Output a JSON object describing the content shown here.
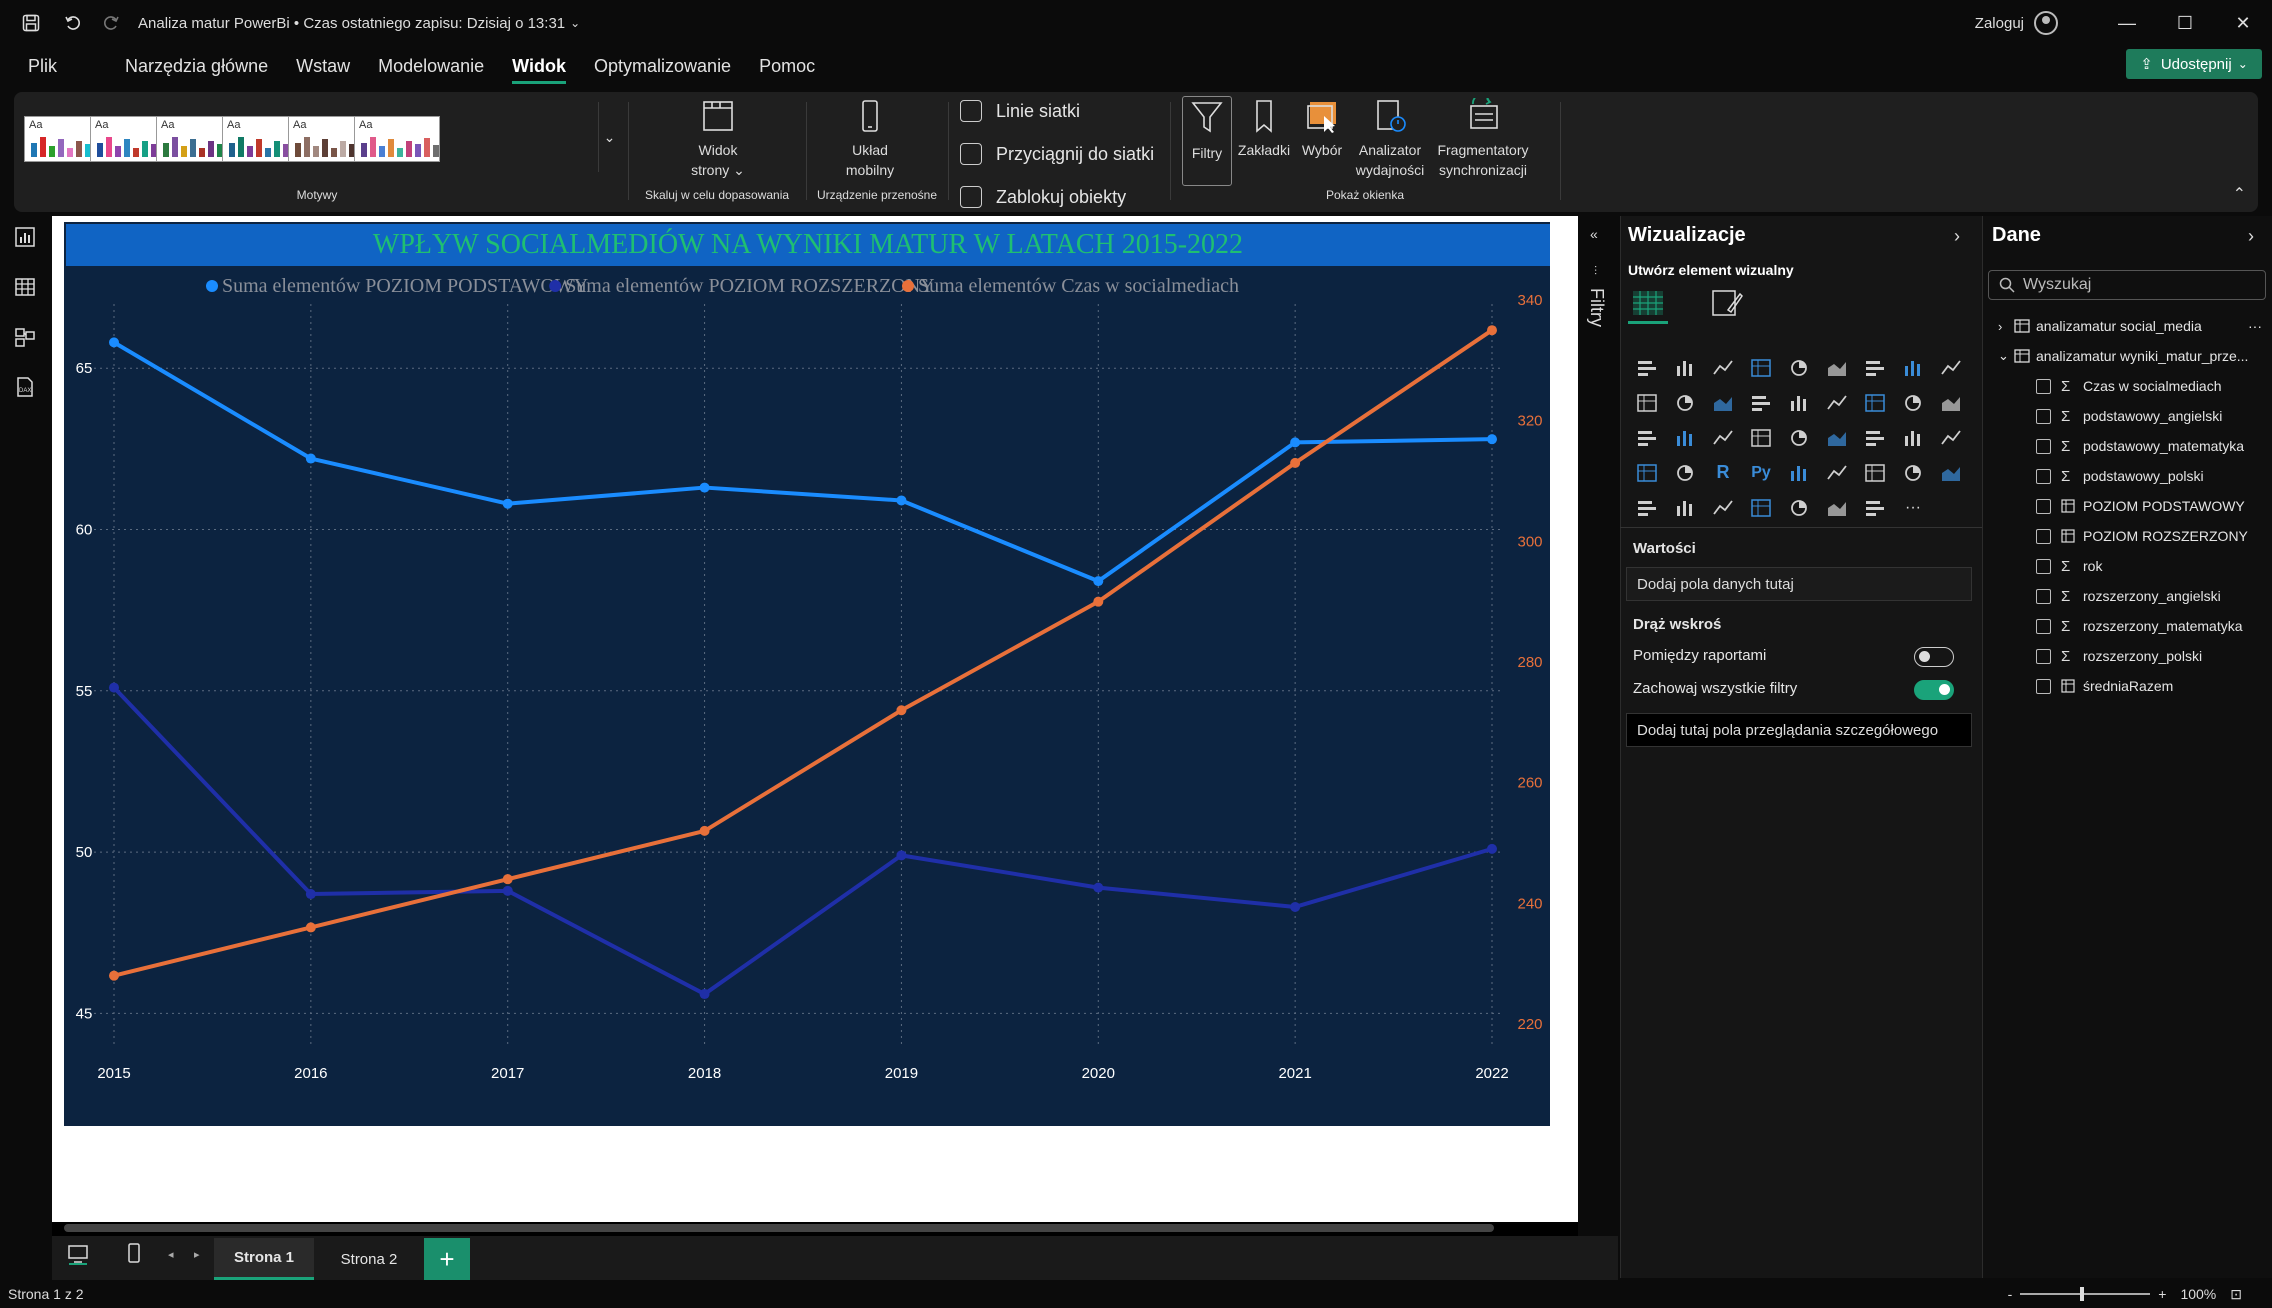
{
  "titlebar": {
    "title": "Analiza matur PowerBi • Czas ostatniego zapisu: Dzisiaj o 13:31",
    "login": "Zaloguj"
  },
  "menu": [
    {
      "label": "Plik"
    },
    {
      "label": "Narzędzia główne"
    },
    {
      "label": "Wstaw"
    },
    {
      "label": "Modelowanie"
    },
    {
      "label": "Widok",
      "active": true
    },
    {
      "label": "Optymalizowanie"
    },
    {
      "label": "Pomoc"
    }
  ],
  "share_label": "Udostępnij",
  "ribbon": {
    "themes_label": "Motywy",
    "page_view": "Widok",
    "page_view_2": "strony",
    "page_view_group": "Skaluj w celu dopasowania",
    "mobile": "Układ",
    "mobile_2": "mobilny",
    "mobile_group": "Urządzenie przenośne",
    "gridlines": "Linie siatki",
    "snap": "Przyciągnij do siatki",
    "lock": "Zablokuj obiekty",
    "filters": "Filtry",
    "bookmarks": "Zakładki",
    "selection": "Wybór",
    "perf": "Analizator",
    "perf_2": "wydajności",
    "sync": "Fragmentatory",
    "sync_2": "synchronizacji",
    "show_panes": "Pokaż okienka",
    "theme_colors": [
      [
        "#1f77b4",
        "#d62728",
        "#2ca02c",
        "#9467bd",
        "#e377c2",
        "#8c564b",
        "#17becf",
        "#bcbd22",
        "#7f7f7f"
      ],
      [
        "#1f4e9c",
        "#e8478b",
        "#8e44ad",
        "#2e86c1",
        "#c0392b",
        "#16a085",
        "#7d3c98",
        "#d35400",
        "#34495e"
      ],
      [
        "#2c7a3f",
        "#7b4fa0",
        "#d4a017",
        "#3c6e91",
        "#a93226",
        "#6c3483",
        "#1e8449",
        "#b9770e",
        "#5d6d7e"
      ],
      [
        "#1f618d",
        "#117a65",
        "#7d3c98",
        "#c0392b",
        "#2874a6",
        "#148f77",
        "#884ea0",
        "#ca6f1e",
        "#424949"
      ],
      [
        "#6e4b3a",
        "#8d6e63",
        "#a1887f",
        "#5d4037",
        "#795548",
        "#bcaaa4",
        "#4e342e",
        "#3e2723",
        "#9e9e9e"
      ],
      [
        "#5b3f8c",
        "#e05a8a",
        "#4a7fd4",
        "#e08a3c",
        "#3cb39b",
        "#c2417a",
        "#7a56b8",
        "#d95f5f",
        "#6e6e6e"
      ]
    ]
  },
  "filters_label": "Filtry",
  "chart_data": {
    "type": "line",
    "title": "WPŁYW SOCIALMEDIÓW NA WYNIKI MATUR W LATACH 2015-2022",
    "x": [
      "2015",
      "2016",
      "2017",
      "2018",
      "2019",
      "2020",
      "2021",
      "2022"
    ],
    "series": [
      {
        "name": "Suma elementów POZIOM PODSTAWOWY",
        "color": "#1a8cff",
        "axis": "left",
        "values": [
          65.8,
          62.2,
          60.8,
          61.3,
          60.9,
          58.4,
          62.7,
          62.8
        ]
      },
      {
        "name": "Suma elementów POZIOM ROZSZERZONY",
        "color": "#1f2fa8",
        "axis": "left",
        "values": [
          55.1,
          48.7,
          48.8,
          45.6,
          49.9,
          48.9,
          48.3,
          50.1
        ]
      },
      {
        "name": "Suma elementów Czas w socialmediach",
        "color": "#e8703a",
        "axis": "right",
        "values": [
          228,
          236,
          244,
          252,
          272,
          290,
          313,
          335
        ]
      }
    ],
    "y_left": {
      "min": 44.3,
      "max": 67.3,
      "ticks": [
        45,
        50,
        55,
        60,
        65
      ]
    },
    "y_right": {
      "min": 218,
      "max": 341,
      "ticks": [
        220,
        240,
        260,
        280,
        300,
        320,
        340
      ]
    },
    "grid": true,
    "legend": "top-center"
  },
  "viz": {
    "title": "Wizualizacje",
    "build": "Utwórz element wizualny",
    "values_label": "Wartości",
    "values_placeholder": "Dodaj pola danych tutaj",
    "drill_label": "Drąż wskroś",
    "cross_report": "Pomiędzy raportami",
    "keep_filters": "Zachowaj wszystkie filtry",
    "drill_placeholder": "Dodaj tutaj pola przeglądania szczegółowego",
    "r_label": "R",
    "py_label": "Py",
    "more_label": "···"
  },
  "data_pane": {
    "title": "Dane",
    "search_placeholder": "Wyszukaj",
    "tables": [
      "analizamatur social_media",
      "analizamatur wyniki_matur_prze..."
    ],
    "fields": [
      {
        "name": "Czas w socialmediach",
        "type": "sum"
      },
      {
        "name": "podstawowy_angielski",
        "type": "sum"
      },
      {
        "name": "podstawowy_matematyka",
        "type": "sum"
      },
      {
        "name": "podstawowy_polski",
        "type": "sum"
      },
      {
        "name": "POZIOM PODSTAWOWY",
        "type": "calc"
      },
      {
        "name": "POZIOM ROZSZERZONY",
        "type": "calc"
      },
      {
        "name": "rok",
        "type": "sum"
      },
      {
        "name": "rozszerzony_angielski",
        "type": "sum"
      },
      {
        "name": "rozszerzony_matematyka",
        "type": "sum"
      },
      {
        "name": "rozszerzony_polski",
        "type": "sum"
      },
      {
        "name": "średniaRazem",
        "type": "calc"
      }
    ]
  },
  "tabs": [
    {
      "label": "Strona 1",
      "active": true
    },
    {
      "label": "Strona 2"
    }
  ],
  "add_tab": "+",
  "status": {
    "page": "Strona 1 z 2",
    "zoom": "100%",
    "zoom_minus": "-",
    "zoom_plus": "+"
  }
}
